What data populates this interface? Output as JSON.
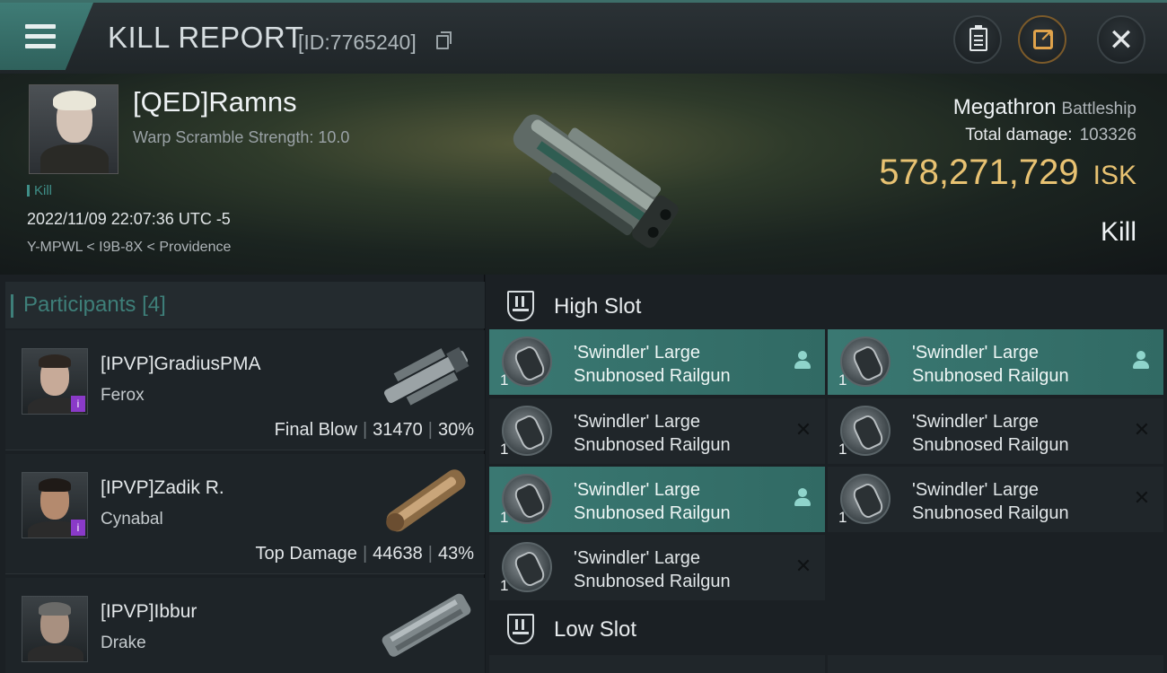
{
  "header": {
    "title": "KILL REPORT",
    "report_id": "[ID:7765240]",
    "icons": [
      "menu-icon",
      "copy-icon",
      "clipboard-icon",
      "share-icon",
      "close-icon"
    ],
    "accent_color": "#3f7c76"
  },
  "banner": {
    "pilot_name": "[QED]Ramns",
    "warp_scramble": "Warp Scramble Strength: 10.0",
    "kill_tag": "Kill",
    "datetime": "2022/11/09 22:07:36 UTC -5",
    "location": "Y-MPWL < I9B-8X < Providence",
    "ship_name": "Megathron",
    "ship_class": "Battleship",
    "total_damage_label": "Total damage:",
    "total_damage_value": "103326",
    "isk_value": "578,271,729",
    "isk_unit": "ISK",
    "result": "Kill",
    "isk_color": "#e8c272"
  },
  "participants": {
    "label": "Participants",
    "count": "[4]",
    "rows": [
      {
        "name": "[IPVP]GradiusPMA",
        "ship": "Ferox",
        "role": "Final Blow",
        "damage": "31470",
        "percent": "30%"
      },
      {
        "name": "[IPVP]Zadik R.",
        "ship": "Cynabal",
        "role": "Top Damage",
        "damage": "44638",
        "percent": "43%"
      },
      {
        "name": "[IPVP]Ibbur",
        "ship": "Drake",
        "role": "",
        "damage": "",
        "percent": ""
      }
    ]
  },
  "slots": {
    "high_slot_title": "High Slot",
    "low_slot_title": "Low Slot",
    "high_items": [
      {
        "qty": "1",
        "name": "'Swindler' Large Snubnosed Railgun",
        "status": "dropped"
      },
      {
        "qty": "1",
        "name": "'Swindler' Large Snubnosed Railgun",
        "status": "dropped"
      },
      {
        "qty": "1",
        "name": "'Swindler' Large Snubnosed Railgun",
        "status": "destroyed"
      },
      {
        "qty": "1",
        "name": "'Swindler' Large Snubnosed Railgun",
        "status": "destroyed"
      },
      {
        "qty": "1",
        "name": "'Swindler' Large Snubnosed Railgun",
        "status": "dropped"
      },
      {
        "qty": "1",
        "name": "'Swindler' Large Snubnosed Railgun",
        "status": "destroyed"
      },
      {
        "qty": "1",
        "name": "'Swindler' Large Snubnosed Railgun",
        "status": "destroyed"
      }
    ],
    "destroyed_mark": "✕",
    "dropped_color": "#316a64"
  }
}
